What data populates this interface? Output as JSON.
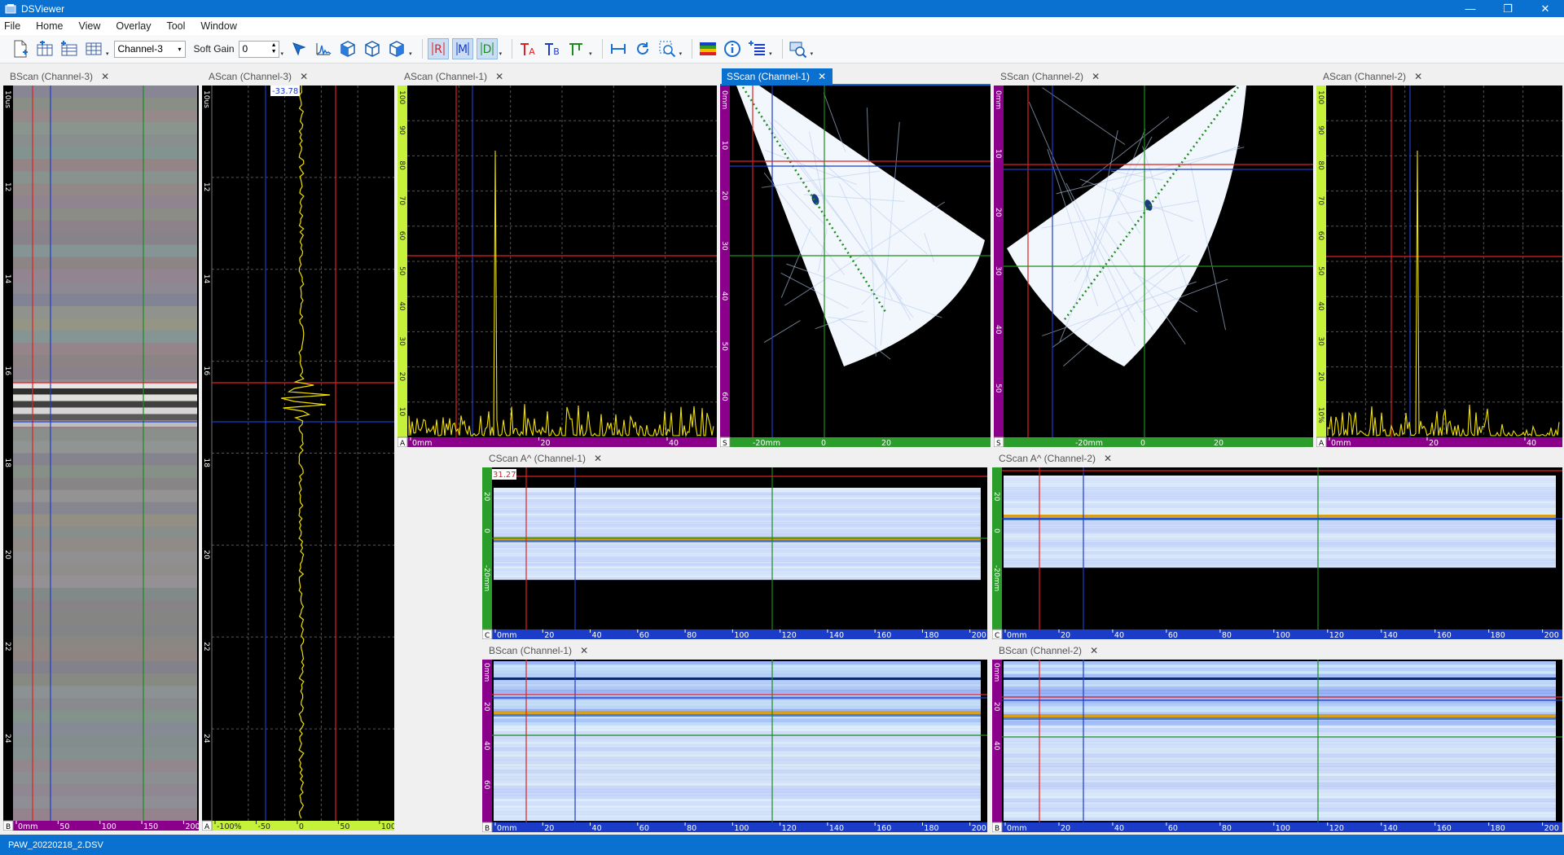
{
  "window": {
    "title": "DSViewer",
    "minimize": "—",
    "restore": "❐",
    "close": "✕"
  },
  "menu": [
    "File",
    "Home",
    "View",
    "Overlay",
    "Tool",
    "Window"
  ],
  "toolbar": {
    "channel": "Channel-3",
    "soft_gain_label": "Soft Gain",
    "soft_gain_value": "0",
    "icons": [
      "new-file-icon",
      "add-table-icon",
      "add-row-icon",
      "view-table-icon",
      "cursor-icon",
      "ascan-icon",
      "cube-icon",
      "cube-outline-icon",
      "cube-rotate-icon",
      "ref-cursor-icon",
      "measure-cursor-icon",
      "data-cursor-icon",
      "text-marker-a-icon",
      "text-marker-b-icon",
      "gate-icon",
      "distance-icon",
      "refresh-icon",
      "zoom-icon",
      "palette-icon",
      "info-icon",
      "list-add-icon",
      "export-icon"
    ],
    "active_letters": {
      "R": "R",
      "M": "M",
      "D": "D",
      "A": "A",
      "B": "B"
    }
  },
  "colors": {
    "accent": "#0a71d1",
    "cursor_red": "#e02020",
    "cursor_blue": "#1a3cc8",
    "cursor_green": "#1c8c1c",
    "signal_yellow": "#f0e000",
    "axis_purple": "#8b008b",
    "axis_green": "#2a9d2a",
    "axis_yellow": "#c6f13a"
  },
  "panels": {
    "bscan_ch3": {
      "tab": "BScan (Channel-3)",
      "corner": "B",
      "x_ticks": [
        "0mm",
        "50",
        "100",
        "150",
        "200"
      ],
      "y_ticks": [
        "10us",
        "12",
        "14",
        "16",
        "18",
        "20",
        "22",
        "24"
      ]
    },
    "ascan_ch3": {
      "tab": "AScan (Channel-3)",
      "corner": "A",
      "readout": "-33.78",
      "x_ticks": [
        "-100%",
        "-50",
        "0",
        "50",
        "100"
      ],
      "y_ticks": [
        "10us",
        "12",
        "14",
        "16",
        "18",
        "20",
        "22",
        "24"
      ]
    },
    "ascan_ch1": {
      "tab": "AScan (Channel-1)",
      "corner": "A",
      "x_ticks": [
        "0mm",
        "20",
        "40"
      ],
      "y_ticks": [
        "100",
        "90",
        "80",
        "70",
        "60",
        "50",
        "40",
        "30",
        "20",
        "10"
      ]
    },
    "sscan_ch1": {
      "tab": "SScan (Channel-1)",
      "corner": "S",
      "x_ticks": [
        "-20mm",
        "0",
        "20"
      ],
      "y_ticks": [
        "0mm",
        "10",
        "20",
        "30",
        "40",
        "50",
        "60"
      ]
    },
    "sscan_ch2": {
      "tab": "SScan (Channel-2)",
      "corner": "S",
      "x_ticks": [
        "-20mm",
        "0",
        "20"
      ],
      "y_ticks": [
        "0mm",
        "10",
        "20",
        "30",
        "40",
        "50"
      ]
    },
    "ascan_ch2": {
      "tab": "AScan (Channel-2)",
      "corner": "A",
      "x_ticks": [
        "0mm",
        "20",
        "40"
      ],
      "y_ticks": [
        "100",
        "90",
        "80",
        "70",
        "60",
        "50",
        "40",
        "30",
        "20",
        "10%"
      ]
    },
    "cscan_ch1": {
      "tab": "CScan A^ (Channel-1)",
      "corner": "C",
      "readout": "31.27",
      "x_ticks": [
        "0mm",
        "20",
        "40",
        "60",
        "80",
        "100",
        "120",
        "140",
        "160",
        "180",
        "200"
      ],
      "y_ticks": [
        "20",
        "0",
        "-20mm"
      ]
    },
    "cscan_ch2": {
      "tab": "CScan A^ (Channel-2)",
      "corner": "C",
      "x_ticks": [
        "0mm",
        "20",
        "40",
        "60",
        "80",
        "100",
        "120",
        "140",
        "160",
        "180",
        "200"
      ],
      "y_ticks": [
        "20",
        "0",
        "-20mm"
      ]
    },
    "bscan_ch1": {
      "tab": "BScan (Channel-1)",
      "corner": "B",
      "x_ticks": [
        "0mm",
        "20",
        "40",
        "60",
        "80",
        "100",
        "120",
        "140",
        "160",
        "180",
        "200"
      ],
      "y_ticks": [
        "0mm",
        "20",
        "40",
        "60"
      ]
    },
    "bscan_ch2": {
      "tab": "BScan (Channel-2)",
      "corner": "B",
      "x_ticks": [
        "0mm",
        "20",
        "40",
        "60",
        "80",
        "100",
        "120",
        "140",
        "160",
        "180",
        "200"
      ],
      "y_ticks": [
        "0mm",
        "20",
        "40"
      ]
    }
  },
  "status": {
    "file": "PAW_20220218_2.DSV"
  }
}
